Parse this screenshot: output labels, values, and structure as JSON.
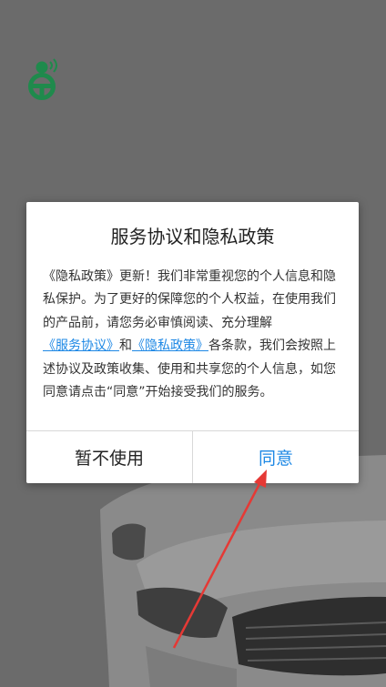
{
  "app": {
    "logo_icon": "steering-wheel-person-icon"
  },
  "dialog": {
    "title": "服务协议和隐私政策",
    "body": {
      "part1": "《隐私政策》更新！我们非常重视您的个人信息和隐私保护。为了更好的保障您的个人权益，在使用我们的产品前，请您务必审慎阅读、充分理解",
      "link_service": "《服务协议》",
      "part2": "和",
      "link_privacy": "《隐私政策》",
      "part3": "各条款，我们会按照上述协议及政策收集、使用和共享您的个人信息，如您同意请点击“同意”开始接受我们的服务。"
    },
    "decline_label": "暂不使用",
    "agree_label": "同意"
  },
  "colors": {
    "overlay": "#6b6b6b",
    "accent": "#1e88e5",
    "logo_green": "#1f8a4c",
    "annotation_arrow": "#e53935"
  }
}
